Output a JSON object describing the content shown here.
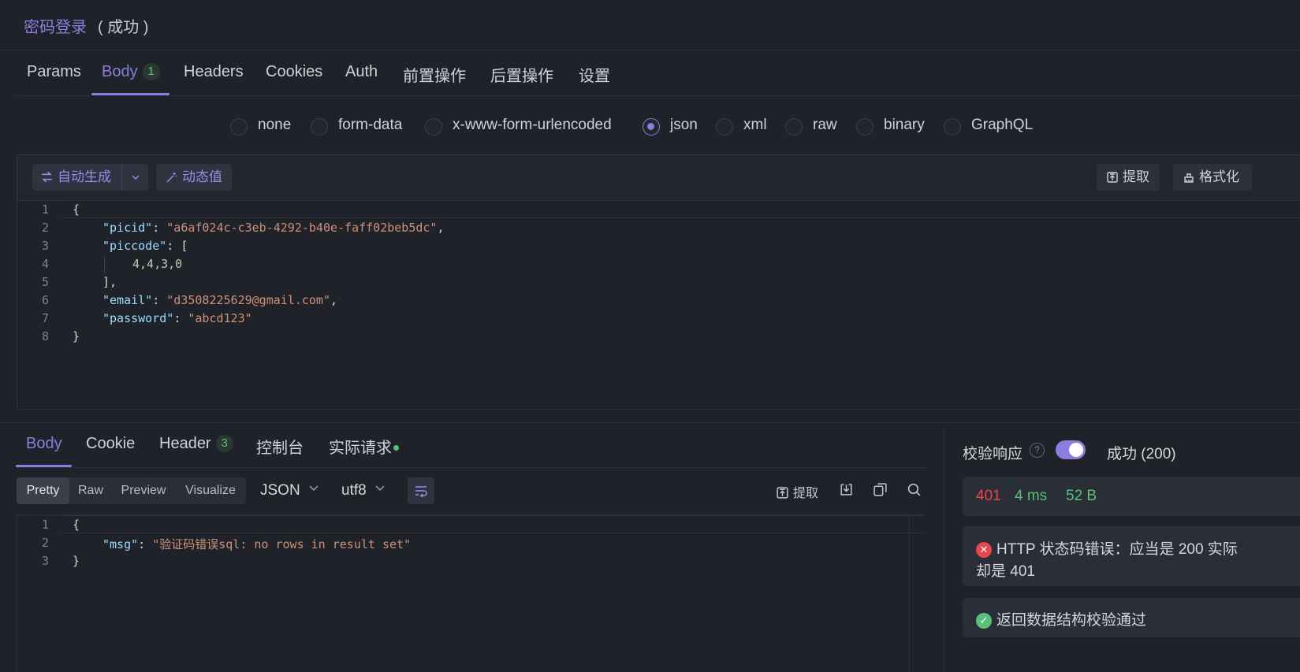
{
  "title": {
    "name": "密码登录",
    "status": "( 成功 )"
  },
  "request_tabs": [
    {
      "label": "Params"
    },
    {
      "label": "Body",
      "badge": "1"
    },
    {
      "label": "Headers"
    },
    {
      "label": "Cookies"
    },
    {
      "label": "Auth"
    },
    {
      "label": "前置操作"
    },
    {
      "label": "后置操作"
    },
    {
      "label": "设置"
    }
  ],
  "body_types": [
    "none",
    "form-data",
    "x-www-form-urlencoded",
    "json",
    "xml",
    "raw",
    "binary",
    "GraphQL"
  ],
  "body_type_selected": "json",
  "editor_toolbar": {
    "auto_generate": "自动生成",
    "dynamic_value": "动态值",
    "extract": "提取",
    "format": "格式化"
  },
  "request_body": {
    "line_numbers": [
      "1",
      "2",
      "3",
      "4",
      "5",
      "6",
      "7",
      "8"
    ],
    "l1": "{",
    "picid_key": "\"picid\"",
    "picid_val": "\"a6af024c-c3eb-4292-b40e-faff02beb5dc\"",
    "piccode_key": "\"piccode\"",
    "piccode_val": "4,4,3,0",
    "l5": "],",
    "email_key": "\"email\"",
    "email_val": "\"d3508225629@gmail.com\"",
    "password_key": "\"password\"",
    "password_val": "\"abcd123\"",
    "l8": "}"
  },
  "response_tabs": [
    {
      "label": "Body"
    },
    {
      "label": "Cookie"
    },
    {
      "label": "Header",
      "badge": "3"
    },
    {
      "label": "控制台"
    },
    {
      "label": "实际请求"
    }
  ],
  "view_modes": [
    "Pretty",
    "Raw",
    "Preview",
    "Visualize"
  ],
  "view_mode_selected": "Pretty",
  "format_select": "JSON",
  "encoding_select": "utf8",
  "response_toolbar": {
    "extract": "提取"
  },
  "response_body": {
    "line_numbers": [
      "1",
      "2",
      "3"
    ],
    "l1": "{",
    "msg_key": "\"msg\"",
    "msg_val": "\"验证码错误sql: no rows in result set\"",
    "l3": "}"
  },
  "validation": {
    "label": "校验响应",
    "enabled": true,
    "result": "成功 (200)",
    "status_code": "401",
    "time": "4 ms",
    "size": "52 B",
    "error_line1": "HTTP 状态码错误：应当是 200 实际",
    "error_line2": "却是 401",
    "ok_message": "返回数据结构校验通过"
  },
  "colors": {
    "accent": "#8e7cde",
    "error": "#e5484d",
    "success": "#5bbf7a",
    "background": "#1f2329"
  }
}
